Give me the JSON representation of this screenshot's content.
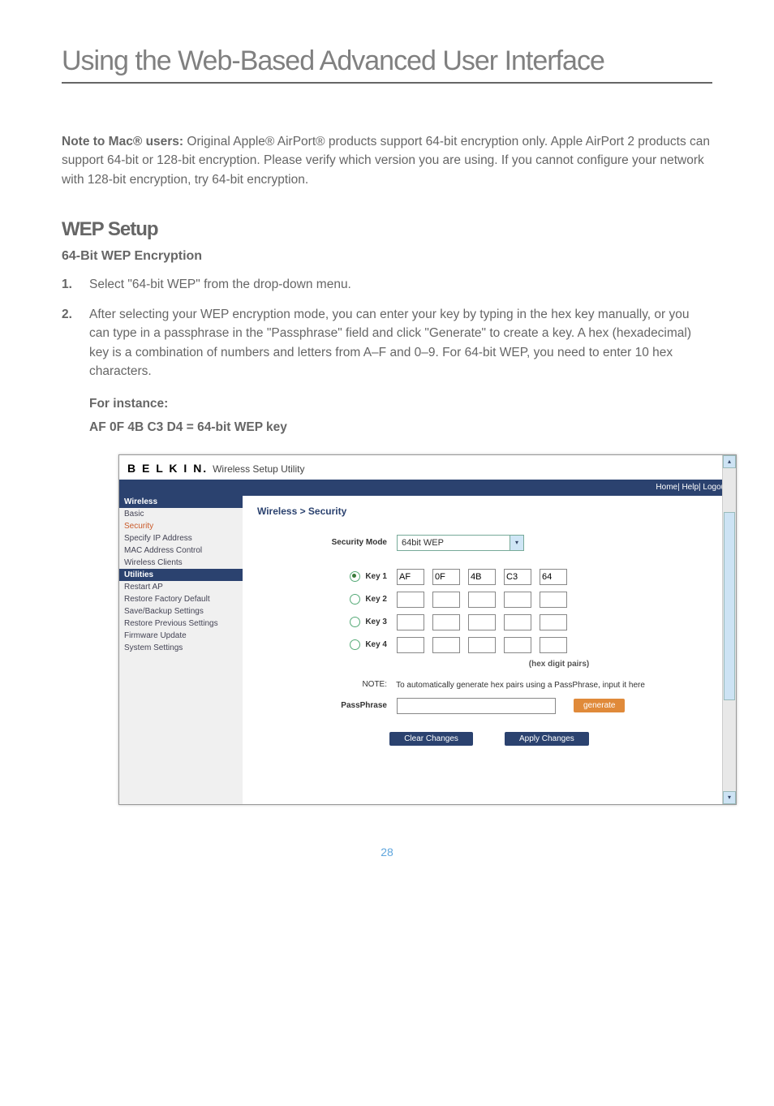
{
  "titlebar": "Using the Web-Based Advanced User Interface",
  "note_paragraph": "Note to Mac® users: Original Apple® AirPort® products support 64-bit encryption only. Apple AirPort 2 products can support 64-bit or 128-bit encryption. Please verify which version you are using. If you cannot configure your network with 128-bit encryption, try 64-bit encryption.",
  "note_strong": "Note to Mac® users:",
  "note_rest": " Original Apple® AirPort® products support 64-bit encryption only. Apple AirPort 2 products can support 64-bit or 128-bit encryption. Please verify which version you are using. If you cannot configure your network with 128-bit encryption, try 64-bit encryption.",
  "section_title": "WEP Setup",
  "subsection_title": "64-Bit WEP Encryption",
  "steps": {
    "1": "Select \"64-bit WEP\" from the drop-down menu.",
    "2": "After selecting your WEP encryption mode, you can enter your key by typing in the hex key manually, or you can type in a passphrase in the \"Passphrase\" field and click \"Generate\" to create a key. A hex (hexadecimal) key is a combination of numbers and letters from A–F and 0–9. For 64-bit WEP, you need to enter 10 hex characters."
  },
  "for_instance_label": "For instance:",
  "wep_example": "AF 0F 4B C3 D4 = 64-bit WEP key",
  "app": {
    "brand": "B E L K I N.",
    "brand_sub": "Wireless Setup Utility",
    "topbar": "Home| Help| Logout",
    "sidebar": {
      "hdr1": "Wireless",
      "items1": [
        "Basic",
        "Security",
        "Specify IP Address",
        "MAC Address Control",
        "Wireless Clients"
      ],
      "hdr2": "Utilities",
      "items2": [
        "Restart AP",
        "Restore Factory Default",
        "Save/Backup Settings",
        "Restore Previous Settings",
        "Firmware Update",
        "System Settings"
      ]
    },
    "crumb": "Wireless > Security",
    "security_mode_label": "Security Mode",
    "security_mode_value": "64bit WEP",
    "keys": {
      "1": {
        "label": "Key 1",
        "vals": [
          "AF",
          "0F",
          "4B",
          "C3",
          "64"
        ]
      },
      "2": {
        "label": "Key 2",
        "vals": [
          "",
          "",
          "",
          "",
          ""
        ]
      },
      "3": {
        "label": "Key 3",
        "vals": [
          "",
          "",
          "",
          "",
          ""
        ]
      },
      "4": {
        "label": "Key 4",
        "vals": [
          "",
          "",
          "",
          "",
          ""
        ]
      }
    },
    "hex_note": "(hex digit pairs)",
    "note_label": "NOTE:",
    "note_text": "To automatically generate hex pairs using a PassPhrase, input it here",
    "passphrase_label": "PassPhrase",
    "btn_generate": "generate",
    "btn_clear": "Clear Changes",
    "btn_apply": "Apply Changes"
  },
  "page_number": "28"
}
